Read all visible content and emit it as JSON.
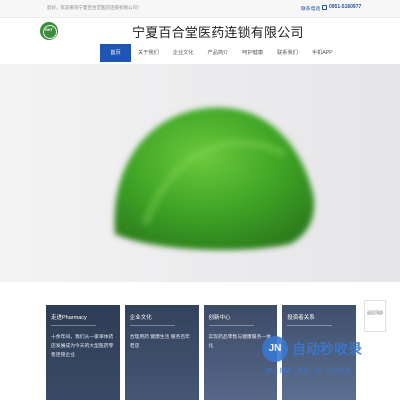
{
  "topbar": {
    "welcome": "您好，欢迎来到宁夏百合堂医药连锁有限公司！",
    "hotline_label": "联系电话",
    "hotline_number": "0951-5160977"
  },
  "header": {
    "logo_text": "BHT",
    "company_name": "宁夏百合堂医药连锁有限公司"
  },
  "nav": {
    "items": [
      {
        "label": "首页",
        "active": true
      },
      {
        "label": "关于我们"
      },
      {
        "label": "企业文化"
      },
      {
        "label": "产品简介"
      },
      {
        "label": "呵护健康"
      },
      {
        "label": "联系我们"
      },
      {
        "label": "手机APP"
      }
    ]
  },
  "cards": [
    {
      "title": "走进Pharmacy",
      "text": "十余年间，我们从一家单体药店发展成为今天的大型医药零售连锁企业"
    },
    {
      "title": "企业文化",
      "text": "合理用药 健康生活 服务百年老店"
    },
    {
      "title": "创新中心",
      "text": "实现药品零售与健康服务一体化"
    },
    {
      "title": "投资者关系",
      "text": ""
    }
  ],
  "side_float": {
    "label": "返回顶部"
  },
  "watermark": {
    "circle": "JN",
    "title": "自动秒收录",
    "subtitle": "网上 精确 · 来访一次 · 自动收录"
  },
  "colors": {
    "nav_active": "#1f56b3",
    "brand_green": "#3d8c3d",
    "card_bg": "#2f3c55",
    "watermark": "#3a78d0"
  }
}
